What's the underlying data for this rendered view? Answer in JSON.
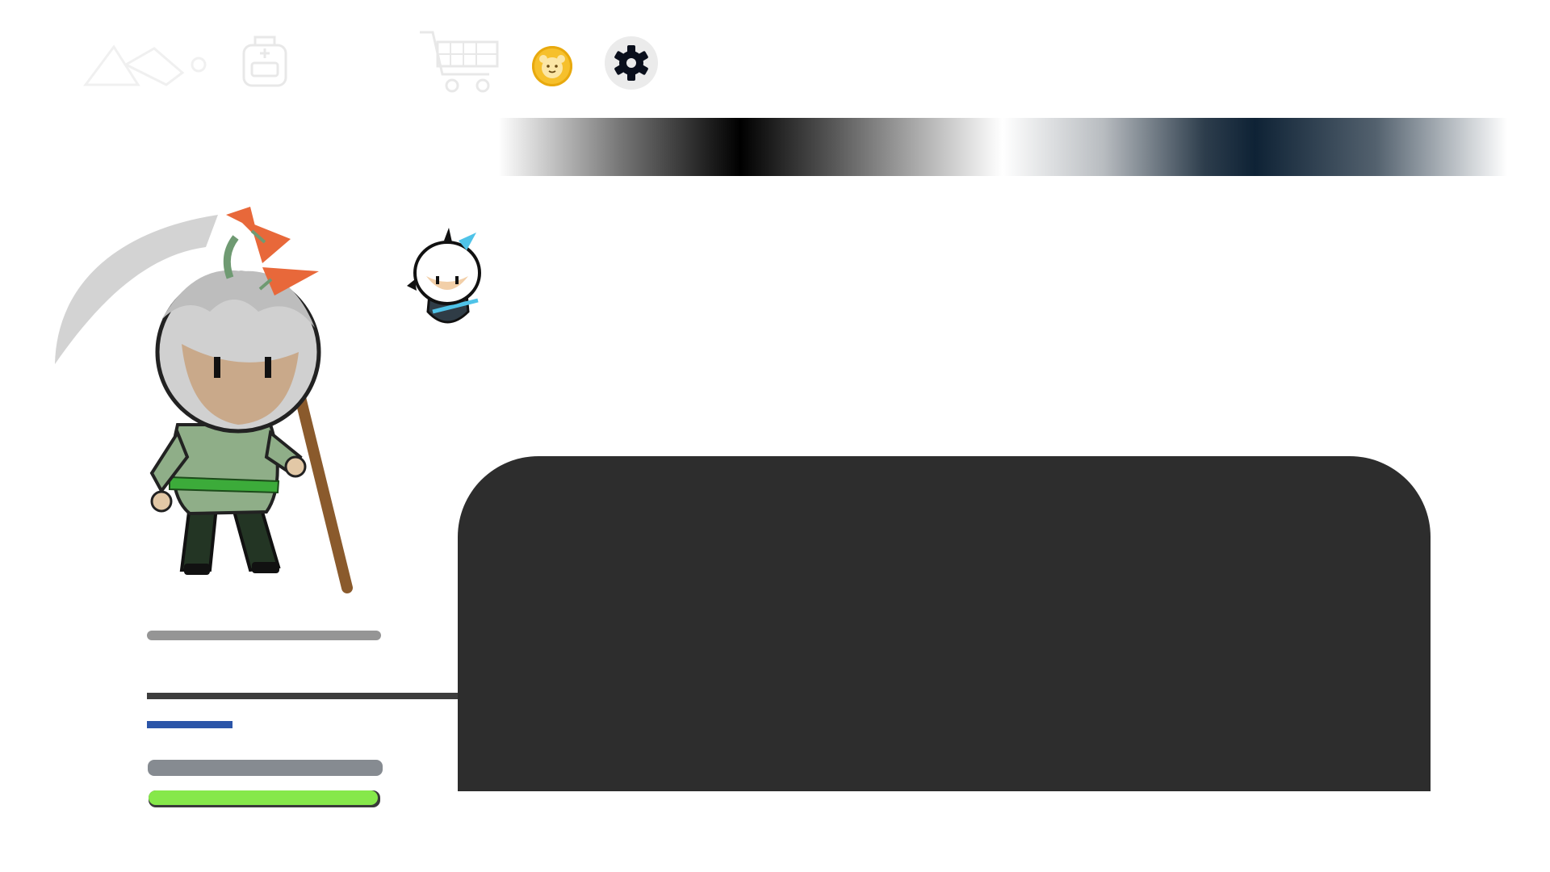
{
  "topbar": {
    "icons": [
      "profile-icon",
      "backpack-icon",
      "shop-cart-icon",
      "coin-icon",
      "settings-icon"
    ]
  },
  "colors": {
    "coin": "#f6c02c",
    "panel": "#2d2d2d",
    "health": "#86e84a",
    "mana": "#2b55a8",
    "bar_gray": "#868b91"
  },
  "hero": {
    "icon": "hero-character-image"
  },
  "companion": {
    "icon": "companion-character-image"
  },
  "stats": {
    "progress_fraction": 0.28,
    "health_fraction": 0.99
  }
}
